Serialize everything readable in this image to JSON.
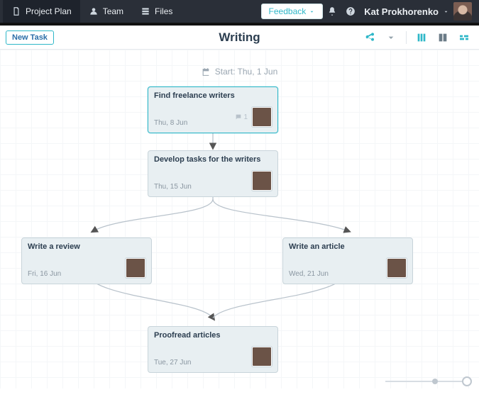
{
  "topnav": {
    "items": [
      {
        "label": "Project Plan",
        "icon": "doc-icon",
        "active": true
      },
      {
        "label": "Team",
        "icon": "team-icon",
        "active": false
      },
      {
        "label": "Files",
        "icon": "files-icon",
        "active": false
      }
    ],
    "feedback_label": "Feedback",
    "user_name": "Kat Prokhorenko"
  },
  "subheader": {
    "new_task_label": "New Task",
    "page_title": "Writing"
  },
  "start_label": "Start: Thu, 1 Jun",
  "tasks": {
    "find_writers": {
      "title": "Find freelance writers",
      "date": "Thu, 8 Jun",
      "comments": 1,
      "highlight": true,
      "avatar": "ava-m1"
    },
    "develop_tasks": {
      "title": "Develop tasks for the writers",
      "date": "Thu, 15 Jun",
      "comments": 0,
      "highlight": false,
      "avatar": "ava-grid"
    },
    "write_review": {
      "title": "Write a review",
      "date": "Fri, 16 Jun",
      "comments": 0,
      "highlight": false,
      "avatar": "ava-desk"
    },
    "write_article": {
      "title": "Write an article",
      "date": "Wed, 21 Jun",
      "comments": 0,
      "highlight": false,
      "avatar": "ava-f1"
    },
    "proofread": {
      "title": "Proofread articles",
      "date": "Tue, 27 Jun",
      "comments": 0,
      "highlight": false,
      "avatar": "ava-f2"
    }
  }
}
